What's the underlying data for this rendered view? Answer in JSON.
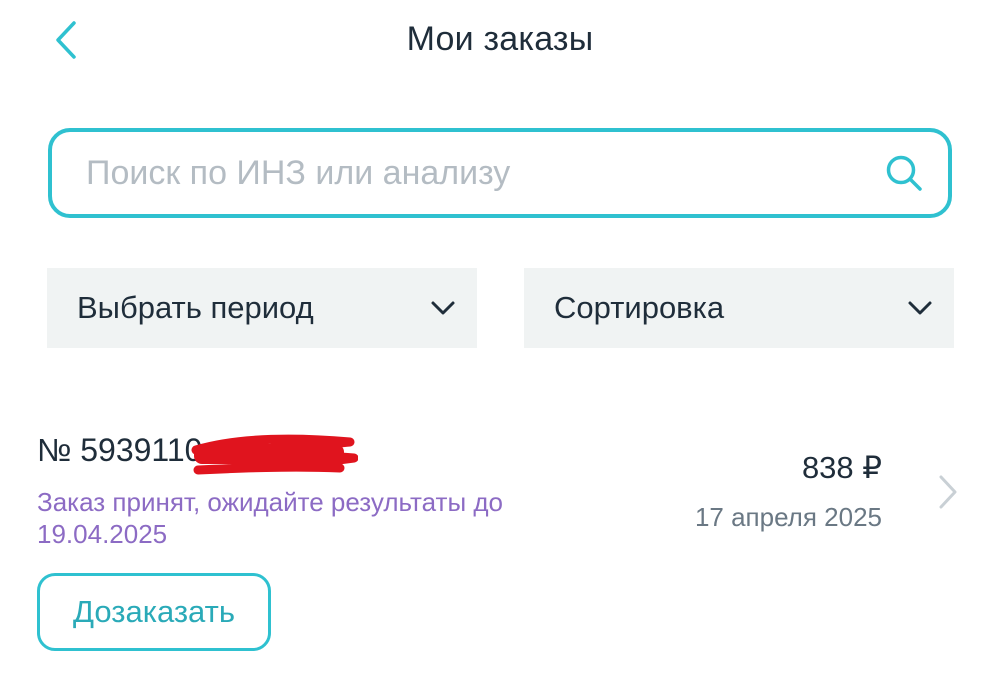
{
  "header": {
    "title": "Мои заказы",
    "back_icon": "chevron-left-icon"
  },
  "search": {
    "placeholder": "Поиск по ИНЗ или анализу",
    "value": "",
    "icon": "search-icon"
  },
  "filters": {
    "period_label": "Выбрать период",
    "sort_label": "Сортировка"
  },
  "orders": [
    {
      "number": "№ 5939110",
      "status": "Заказ принят, ожидайте результаты до 19.04.2025",
      "price": "838 ₽",
      "date": "17 апреля 2025",
      "reorder_label": "Дозаказать"
    }
  ],
  "colors": {
    "accent": "#2fc1d0",
    "status_text": "#8c6bc4",
    "filter_bg": "#f0f3f3",
    "redaction": "#e0141e"
  }
}
